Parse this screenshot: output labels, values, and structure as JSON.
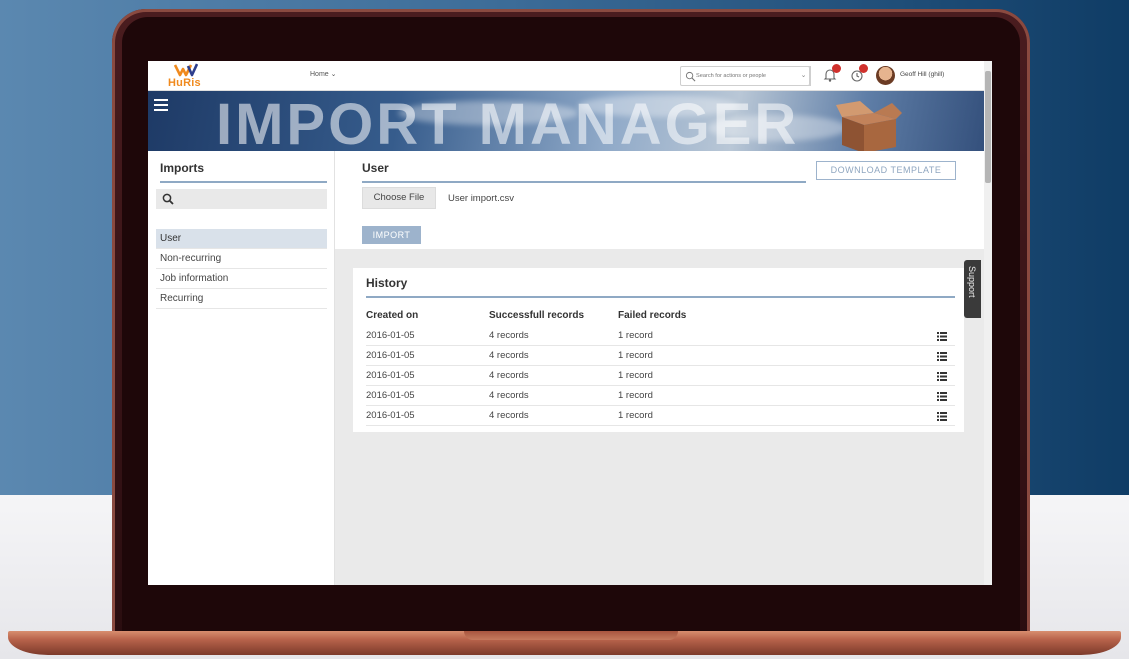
{
  "app": {
    "logo_text": "HuRis"
  },
  "topbar": {
    "home_menu": "Home",
    "search_placeholder": "Search for actions or people",
    "user_name": "Geoff Hill (ghill)"
  },
  "banner": {
    "title": "IMPORT MANAGER"
  },
  "sidebar": {
    "title": "Imports",
    "items": [
      {
        "label": "User",
        "active": true
      },
      {
        "label": "Non-recurring"
      },
      {
        "label": "Job information"
      },
      {
        "label": "Recurring"
      }
    ]
  },
  "user_panel": {
    "title": "User",
    "download_label": "DOWNLOAD TEMPLATE",
    "choose_file_label": "Choose File",
    "file_name": "User import.csv",
    "import_label": "IMPORT"
  },
  "history": {
    "title": "History",
    "columns": [
      "Created on",
      "Successfull records",
      "Failed records"
    ],
    "rows": [
      [
        "2016-01-05",
        "4 records",
        "1 record"
      ],
      [
        "2016-01-05",
        "4 records",
        "1 record"
      ],
      [
        "2016-01-05",
        "4 records",
        "1 record"
      ],
      [
        "2016-01-05",
        "4 records",
        "1 record"
      ],
      [
        "2016-01-05",
        "4 records",
        "1 record"
      ]
    ]
  },
  "support": {
    "label": "Support"
  },
  "colors": {
    "accent": "#9db3cc",
    "brand": "#f08a1e",
    "badge": "#d0312d"
  }
}
